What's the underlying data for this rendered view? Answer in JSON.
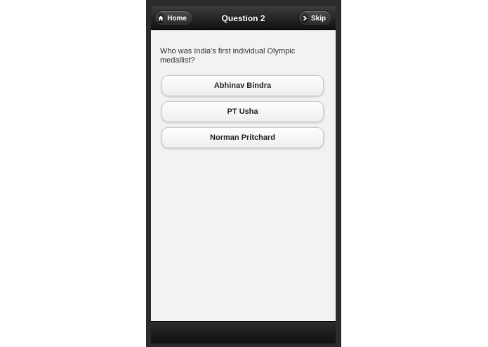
{
  "header": {
    "title": "Question 2",
    "home_label": "Home",
    "skip_label": "Skip",
    "home_icon": "home-icon",
    "skip_icon": "chevron-right-icon"
  },
  "question": {
    "text": "Who was India's first individual Olympic medallist?"
  },
  "answers": [
    {
      "label": "Abhinav Bindra"
    },
    {
      "label": "PT Usha"
    },
    {
      "label": "Norman Pritchard"
    }
  ],
  "colors": {
    "header_bg": "#1e1e1e",
    "page_bg": "#f2f2f2",
    "answer_bg": "#f8f8f8",
    "device_frame": "#2b2b2b"
  }
}
